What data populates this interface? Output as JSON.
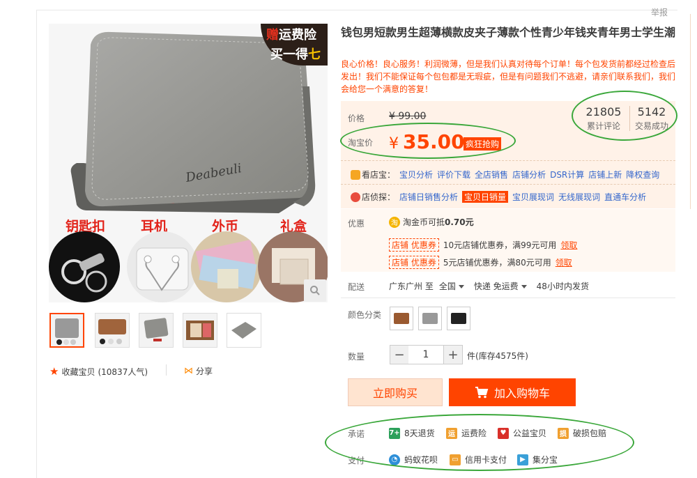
{
  "top": {
    "report": "举报"
  },
  "gallery": {
    "promo_line1_a": "赠",
    "promo_line1_b": "运费险",
    "promo_line2_a": "买一得",
    "promo_line2_b": "七",
    "brand_script": "Deabeuli",
    "accessories": [
      "钥匙扣",
      "耳机",
      "外币",
      "礼盒"
    ],
    "zoom_icon": "magnifier-icon",
    "favorite_label": "收藏宝贝",
    "favorite_count": "(10837人气)",
    "share_label": "分享"
  },
  "product": {
    "title": "钱包男短款男生超薄横款皮夹子薄款个性青少年钱夹青年男士学生潮",
    "description": "良心价格！良心服务！利润微薄，但是我们认真对待每个订单！每个包发货前都经过检查后发出！我们不能保证每个包包都是无瑕疵，但是有问题我们不逃避，请亲们联系我们，我们会给您一个满意的答复！"
  },
  "price": {
    "label_price": "价格",
    "original": "¥ 99.00",
    "label_taobao": "淘宝价",
    "currency": "¥",
    "current": "35.00",
    "badge": "疯狂抢购",
    "reviews_count": "21805",
    "reviews_label": "累计评论",
    "deals_count": "5142",
    "deals_label": "交易成功"
  },
  "tools": {
    "row1_head": "看店宝：",
    "row1_links": [
      "宝贝分析",
      "评价下载",
      "全店销售",
      "店铺分析",
      "DSR计算",
      "店铺上新",
      "降权查询"
    ],
    "row2_head": "店侦探：",
    "row2_links": [
      "店铺日销售分析",
      "宝贝日销量",
      "宝贝展现词",
      "无线展现词",
      "直通车分析"
    ]
  },
  "promotion": {
    "label": "优惠",
    "coin_icon": "淘",
    "coin_text": "淘金币可抵",
    "coin_value": "0.70元",
    "coupons": [
      {
        "tag": "店铺 优惠券",
        "text": "10元店铺优惠券，满99元可用",
        "action": "领取"
      },
      {
        "tag": "店铺 优惠券",
        "text": "5元店铺优惠券，满80元可用",
        "action": "领取"
      }
    ]
  },
  "shipping": {
    "label": "配送",
    "from": "广东广州 至",
    "to": "全国",
    "method": "快递 免运费",
    "dispatch": "48小时内发货"
  },
  "sku": {
    "label": "颜色分类"
  },
  "quantity": {
    "label": "数量",
    "minus": "−",
    "value": "1",
    "plus": "+",
    "unit": "件",
    "stock": "(库存4575件)"
  },
  "actions": {
    "buy_now": "立即购买",
    "add_to_cart": "加入购物车"
  },
  "services": {
    "promise_label": "承诺",
    "promise_items": [
      "8天退货",
      "运费险",
      "公益宝贝",
      "破损包赔"
    ],
    "pay_label": "支付",
    "pay_items": [
      "蚂蚁花呗",
      "信用卡支付",
      "集分宝"
    ]
  },
  "colors": {
    "accent": "#ff4400",
    "price_bg": "#fff2e8",
    "link": "#3366cc",
    "annotation": "#3aa73a"
  }
}
